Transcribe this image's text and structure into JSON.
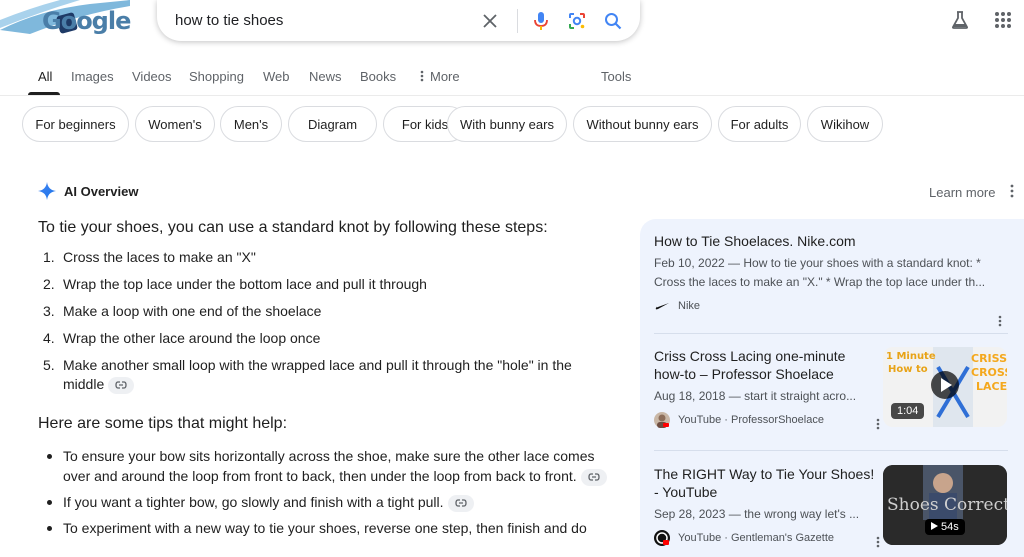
{
  "header": {
    "logo_text": "Google",
    "search_query": "how to tie shoes"
  },
  "tabs": [
    {
      "label": "All",
      "active": true
    },
    {
      "label": "Images"
    },
    {
      "label": "Videos"
    },
    {
      "label": "Shopping"
    },
    {
      "label": "Web"
    },
    {
      "label": "News"
    },
    {
      "label": "Books"
    },
    {
      "label": "More"
    },
    {
      "label": "Tools"
    }
  ],
  "chips": [
    "For beginners",
    "Women's",
    "Men's",
    "Diagram",
    "For kids",
    "With bunny ears",
    "Without bunny ears",
    "For adults",
    "Wikihow"
  ],
  "ai_overview": {
    "title": "AI Overview",
    "learn_more": "Learn more",
    "intro": "To tie your shoes, you can use a standard knot by following these steps:",
    "steps": [
      {
        "num": "1.",
        "text": "Cross the laces to make an \"X\""
      },
      {
        "num": "2.",
        "text": "Wrap the top lace under the bottom lace and pull it through"
      },
      {
        "num": "3.",
        "text": "Make a loop with one end of the shoelace"
      },
      {
        "num": "4.",
        "text": "Wrap the other lace around the loop once"
      },
      {
        "num": "5.",
        "text": "Make another small loop with the wrapped lace and pull it through the \"hole\" in the middle"
      }
    ],
    "tips_heading": "Here are some tips that might help:",
    "tips": [
      "To ensure your bow sits horizontally across the shoe, make sure the other lace comes over and around the loop from front to back, then under the loop from back to front.",
      "If you want a tighter bow, go slowly and finish with a tight pull.",
      "To experiment with a new way to tie your shoes, reverse one step, then finish and do"
    ]
  },
  "sources": [
    {
      "title": "How to Tie Shoelaces. Nike.com",
      "snippet": "Feb 10, 2022 — How to tie your shoes with a standard knot: * Cross the laces to make an \"X.\" * Wrap the top lace under th...",
      "source": "Nike"
    },
    {
      "title": "Criss Cross Lacing one-minute how-to – Professor Shoelace",
      "snippet": "Aug 18, 2018 — start it straight acro...",
      "source": "YouTube · ProfessorShoelace",
      "duration": "1:04",
      "thumb_text": [
        "1 Minute",
        "How to",
        "CRISS",
        "CROSS",
        "LACE"
      ]
    },
    {
      "title": "The RIGHT Way to Tie Your Shoes! - YouTube",
      "snippet": "Sep 28, 2023 — the wrong way let's ...",
      "source": "YouTube · Gentleman's Gazette",
      "duration": "54s",
      "thumb_text": "Shoes Correctly"
    }
  ]
}
